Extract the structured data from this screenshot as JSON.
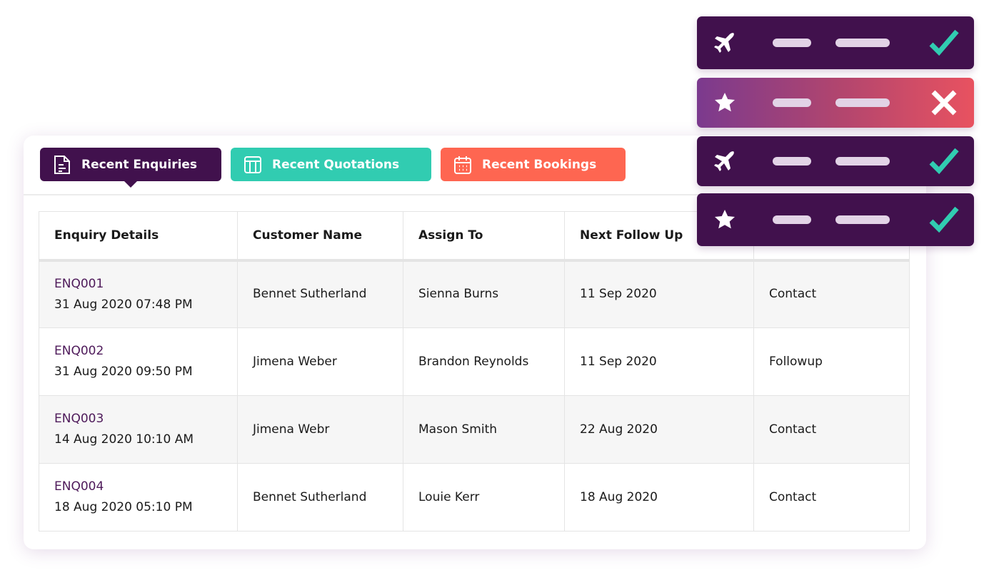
{
  "tabs": [
    {
      "label": "Recent Enquiries",
      "icon": "document-icon",
      "color": "#41114d",
      "active": true
    },
    {
      "label": "Recent Quotations",
      "icon": "table-icon",
      "color": "#31ccb1"
    },
    {
      "label": "Recent Bookings",
      "icon": "calendar-icon",
      "color": "#fe6651"
    }
  ],
  "table": {
    "headers": [
      "Enquiry Details",
      "Customer Name",
      "Assign To",
      "Next Follow Up"
    ],
    "rows": [
      {
        "id": "ENQ001",
        "date": "31 Aug 2020 07:48 PM",
        "customer": "Bennet Sutherland",
        "assign": "Sienna Burns",
        "followup": "11 Sep 2020",
        "status": "Contact"
      },
      {
        "id": "ENQ002",
        "date": "31 Aug 2020 09:50 PM",
        "customer": "Jimena Weber",
        "assign": "Brandon Reynolds",
        "followup": "11 Sep 2020",
        "status": "Followup"
      },
      {
        "id": "ENQ003",
        "date": "14 Aug 2020 10:10 AM",
        "customer": "Jimena Webr",
        "assign": "Mason Smith",
        "followup": "22 Aug 2020",
        "status": "Contact"
      },
      {
        "id": "ENQ004",
        "date": "18 Aug 2020 05:10 PM",
        "customer": "Bennet Sutherland",
        "assign": "Louie Kerr",
        "followup": "18 Aug 2020",
        "status": "Contact"
      }
    ]
  },
  "status_cards": [
    {
      "icon": "plane-icon",
      "status": "check"
    },
    {
      "icon": "star-icon",
      "status": "cross"
    },
    {
      "icon": "plane-icon",
      "status": "check"
    },
    {
      "icon": "star-icon",
      "status": "check"
    }
  ],
  "colors": {
    "primary": "#41114d",
    "teal": "#31ccb1",
    "coral": "#fe6651"
  }
}
